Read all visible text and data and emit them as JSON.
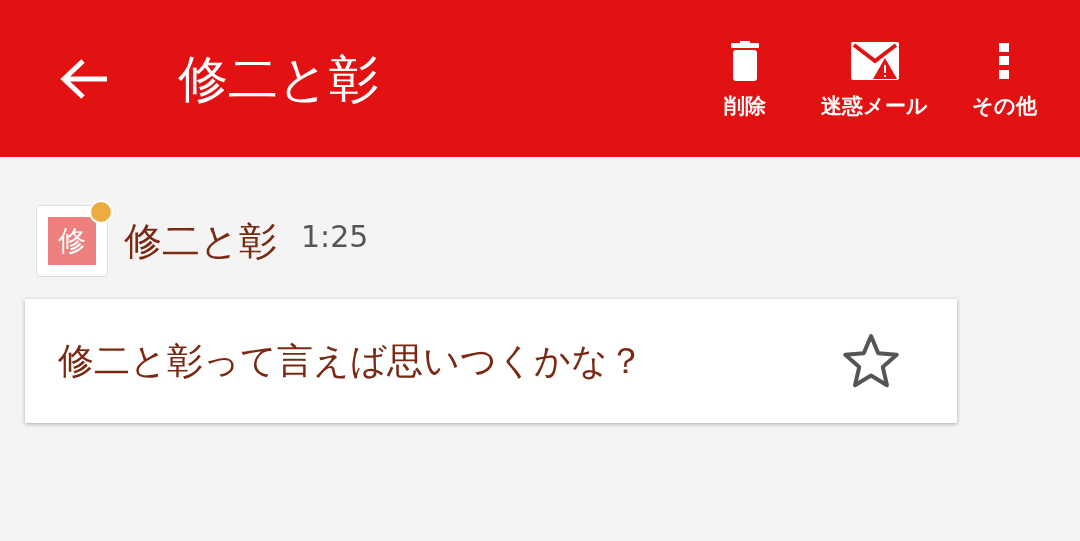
{
  "header": {
    "title": "修二と彰",
    "actions": [
      {
        "kind": "trash",
        "label": "削除"
      },
      {
        "kind": "spam",
        "label": "迷惑メール"
      },
      {
        "kind": "more",
        "label": "その他"
      }
    ]
  },
  "message": {
    "avatar": "修",
    "unread": true,
    "sender": "修二と彰",
    "time": "1:25",
    "body": "修二と彰って言えば思いつくかな？",
    "starred": false
  }
}
